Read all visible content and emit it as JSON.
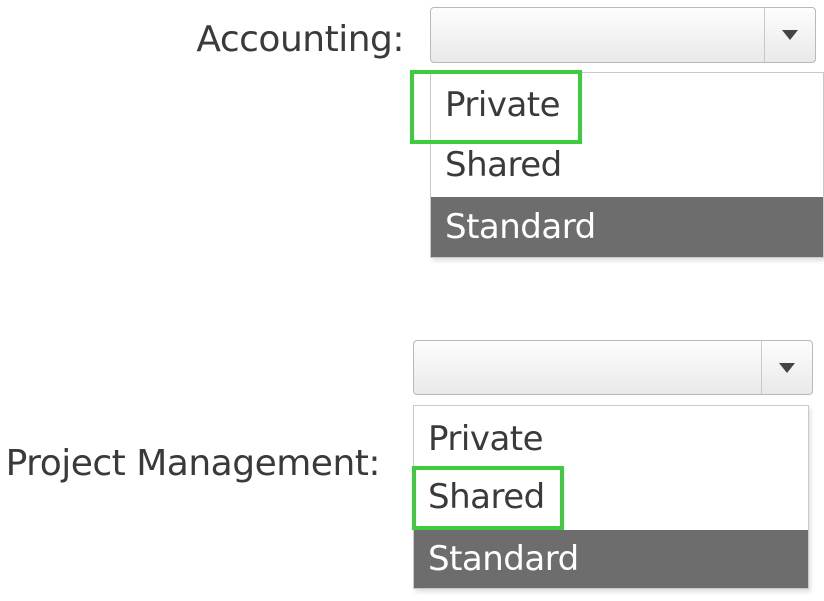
{
  "accounting": {
    "label": "Accounting:",
    "selected_value": "",
    "options": [
      "Private",
      "Shared",
      "Standard"
    ],
    "highlighted_option": "Standard",
    "marked_option": "Private"
  },
  "project_management": {
    "label": "Project Management:",
    "selected_value": "",
    "options": [
      "Private",
      "Shared",
      "Standard"
    ],
    "highlighted_option": "Standard",
    "marked_option": "Shared"
  },
  "icons": {
    "dropdown_arrow": "chevron-down-icon"
  },
  "colors": {
    "highlight_bg": "#6d6d6d",
    "highlight_text": "#ffffff",
    "marker_border": "#3ecc3e",
    "text": "#3a3a3a"
  }
}
